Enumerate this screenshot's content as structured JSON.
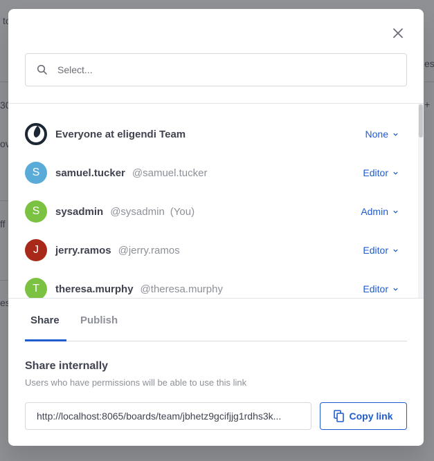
{
  "background": {
    "fragments": [
      "to",
      "es",
      "30",
      "ova",
      "ff",
      "es",
      "+"
    ]
  },
  "modal": {
    "search": {
      "placeholder": "Select...",
      "value": ""
    },
    "members": [
      {
        "name": "Everyone at eligendi Team",
        "handle": "",
        "you": "",
        "role": "None",
        "avatar_letter": "",
        "avatar_color": "#1c2733",
        "is_team": true
      },
      {
        "name": "samuel.tucker",
        "handle": "@samuel.tucker",
        "you": "",
        "role": "Editor",
        "avatar_letter": "S",
        "avatar_color": "#5aabd8"
      },
      {
        "name": "sysadmin",
        "handle": "@sysadmin",
        "you": "(You)",
        "role": "Admin",
        "avatar_letter": "S",
        "avatar_color": "#7cc242"
      },
      {
        "name": "jerry.ramos",
        "handle": "@jerry.ramos",
        "you": "",
        "role": "Editor",
        "avatar_letter": "J",
        "avatar_color": "#a8291a"
      },
      {
        "name": "theresa.murphy",
        "handle": "@theresa.murphy",
        "you": "",
        "role": "Editor",
        "avatar_letter": "T",
        "avatar_color": "#7cc242"
      }
    ],
    "tabs": {
      "share": "Share",
      "publish": "Publish"
    },
    "share_section": {
      "title": "Share internally",
      "subtitle": "Users who have permissions will be able to use this link",
      "link": "http://localhost:8065/boards/team/jbhetz9gcifjjg1rdhs3k...",
      "copy_label": "Copy link"
    }
  },
  "colors": {
    "accent": "#1e5bd1",
    "text": "#3f4350",
    "muted": "#8d9099"
  }
}
